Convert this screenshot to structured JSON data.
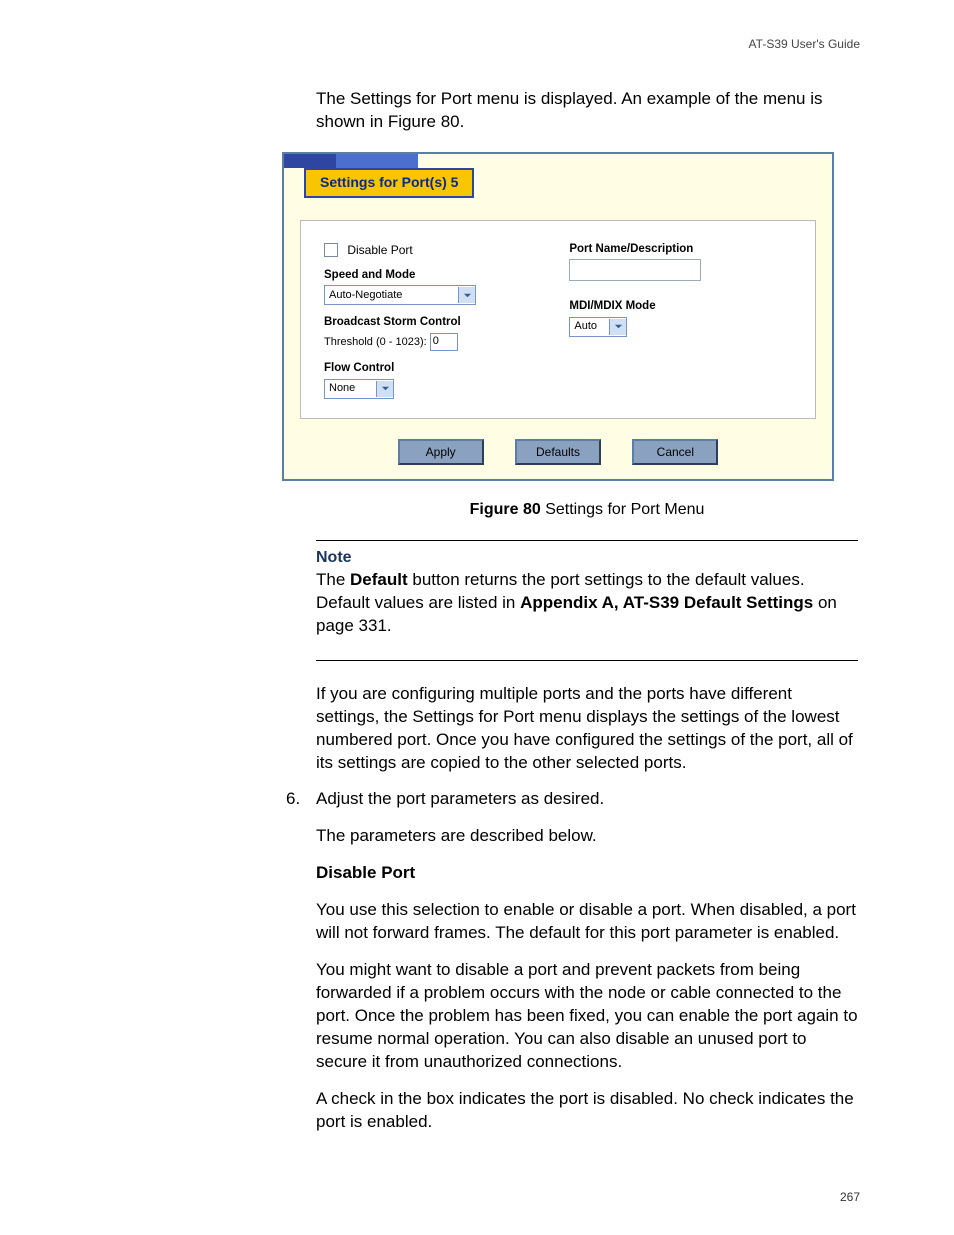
{
  "header": {
    "doc_title": "AT-S39 User's Guide"
  },
  "intro": "The Settings for Port menu is displayed. An example of the menu is shown in Figure 80.",
  "figure": {
    "tab_title": "Settings for Port(s) 5",
    "left": {
      "disable_port": "Disable Port",
      "speed_mode_label": "Speed and Mode",
      "speed_mode_value": "Auto-Negotiate",
      "bsc_label": "Broadcast Storm Control",
      "threshold_label": "Threshold (0 - 1023):",
      "threshold_value": "0",
      "flow_label": "Flow Control",
      "flow_value": "None"
    },
    "right": {
      "portname_label": "Port Name/Description",
      "mdi_label": "MDI/MDIX Mode",
      "mdi_value": "Auto"
    },
    "buttons": {
      "apply": "Apply",
      "defaults": "Defaults",
      "cancel": "Cancel"
    },
    "caption_bold": "Figure 80",
    "caption_rest": "  Settings for Port Menu"
  },
  "note": {
    "heading": "Note",
    "t1": "The ",
    "b1": "Default",
    "t2": " button returns the port settings to the default values. Default values are listed in ",
    "b2": "Appendix A, AT-S39 Default Settings",
    "t3": " on page 331."
  },
  "para_multi": "If you are configuring multiple ports and the ports have different settings, the Settings for Port menu displays the settings of the lowest numbered port. Once you have configured the settings of the port, all of its settings are copied to the other selected ports.",
  "step": {
    "num": "6.",
    "text": "Adjust the port parameters as desired."
  },
  "para_params": "The parameters are described below.",
  "disable": {
    "heading": "Disable Port",
    "p1": "You use this selection to enable or disable a port. When disabled, a port will not forward frames. The default for this port parameter is enabled.",
    "p2": "You might want to disable a port and prevent packets from being forwarded if a problem occurs with the node or cable connected to the port. Once the problem has been fixed, you can enable the port again to resume normal operation. You can also disable an unused port to secure it from unauthorized connections.",
    "p3": "A check in the box indicates the port is disabled. No check indicates the port is enabled."
  },
  "page_number": "267"
}
